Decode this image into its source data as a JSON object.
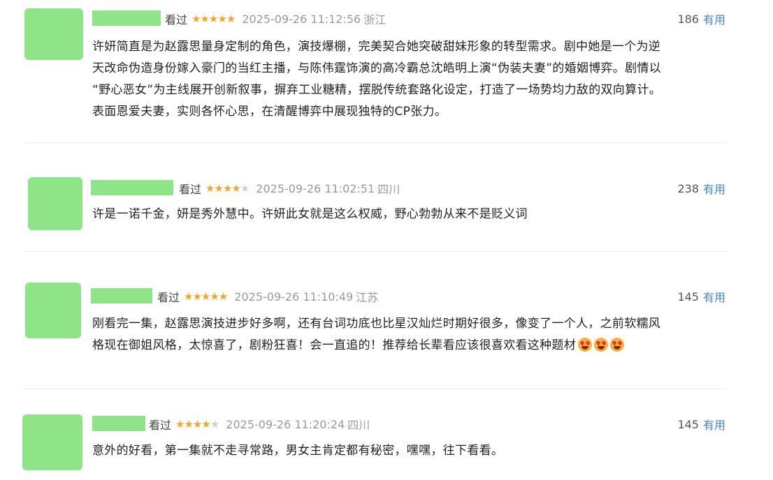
{
  "reviews": [
    {
      "status": "看过",
      "rating": 5,
      "time": "2025-09-26 11:12:56",
      "location": "浙江",
      "votes": "186",
      "useful_label": "有用",
      "lines": [
        "许妍简直是为赵露思量身定制的角色，演技爆棚，完美契合她突破甜妹形象的转型需求。剧中她是一个为逆",
        "天改命伪造身份嫁入豪门的当红主播，与陈伟霆饰演的高冷霸总沈皓明上演“伪装夫妻”的婚姻博弈。剧情以",
        "“野心恶女”为主线展开创新叙事，摒弃工业糖精，摆脱传统套路化设定，打造了一场势均力敌的双向算计。",
        "表面恩爱夫妻，实则各怀心思，在清醒博弈中展现独特的CP张力。"
      ],
      "emoji_count": 0
    },
    {
      "status": "看过",
      "rating": 4,
      "time": "2025-09-26 11:02:51",
      "location": "四川",
      "votes": "238",
      "useful_label": "有用",
      "lines": [
        "许是一诺千金，妍是秀外慧中。许妍此女就是这么权威，野心勃勃从来不是贬义词"
      ],
      "emoji_count": 0
    },
    {
      "status": "看过",
      "rating": 5,
      "time": "2025-09-26 11:10:49",
      "location": "江苏",
      "votes": "145",
      "useful_label": "有用",
      "lines": [
        "刚看完一集，赵露思演技进步好多啊，还有台词功底也比星汉灿烂时期好很多，像变了一个人，之前软糯风",
        "格现在御姐风格，太惊喜了，剧粉狂喜！会一直追的！推荐给长辈看应该很喜欢看这种题材"
      ],
      "emoji_count": 3
    },
    {
      "status": "看过",
      "rating": 4,
      "time": "2025-09-26 11:20:24",
      "location": "四川",
      "votes": "145",
      "useful_label": "有用",
      "lines": [
        "意外的好看，第一集就不走寻常路，男女主肯定都有秘密，嘿嘿，往下看看。"
      ],
      "emoji_count": 0
    }
  ],
  "colors": {
    "avatar_placeholder": "#8ee487",
    "star_on": "#f5a524",
    "star_off": "#cfcfcf",
    "useful_link": "#3f84d8",
    "meta_gray": "#9a9a9a"
  }
}
